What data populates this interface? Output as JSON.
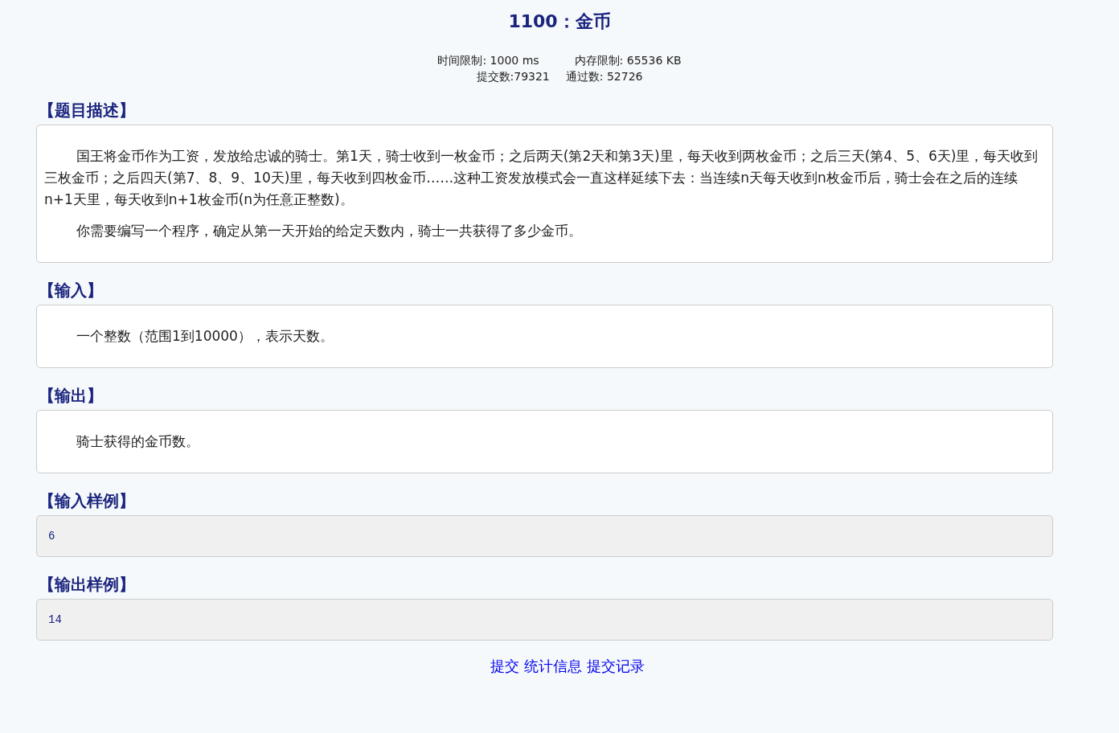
{
  "title": "1100：金币",
  "limits": [
    {
      "label": "时间限制: 1000 ms"
    },
    {
      "label": "内存限制: 65536 KB"
    }
  ],
  "stats": [
    {
      "label": "提交数:79321"
    },
    {
      "label": "通过数: 52726"
    }
  ],
  "sections": [
    {
      "heading": "【题目描述】",
      "kind": "text",
      "paragraphs": [
        "国王将金币作为工资，发放给忠诚的骑士。第1天，骑士收到一枚金币；之后两天(第2天和第3天)里，每天收到两枚金币；之后三天(第4、5、6天)里，每天收到三枚金币；之后四天(第7、8、9、10天)里，每天收到四枚金币……这种工资发放模式会一直这样延续下去：当连续n天每天收到n枚金币后，骑士会在之后的连续n+1天里，每天收到n+1枚金币(n为任意正整数)。",
        "你需要编写一个程序，确定从第一天开始的给定天数内，骑士一共获得了多少金币。"
      ]
    },
    {
      "heading": "【输入】",
      "kind": "text",
      "paragraphs": [
        "一个整数（范围1到10000），表示天数。"
      ]
    },
    {
      "heading": "【输出】",
      "kind": "text",
      "paragraphs": [
        "骑士获得的金币数。"
      ]
    },
    {
      "heading": "【输入样例】",
      "kind": "sample",
      "paragraphs": [
        "6"
      ]
    },
    {
      "heading": "【输出样例】",
      "kind": "sample",
      "paragraphs": [
        "14"
      ]
    }
  ],
  "links": [
    {
      "label": "提交"
    },
    {
      "label": "统计信息"
    },
    {
      "label": "提交记录"
    }
  ]
}
